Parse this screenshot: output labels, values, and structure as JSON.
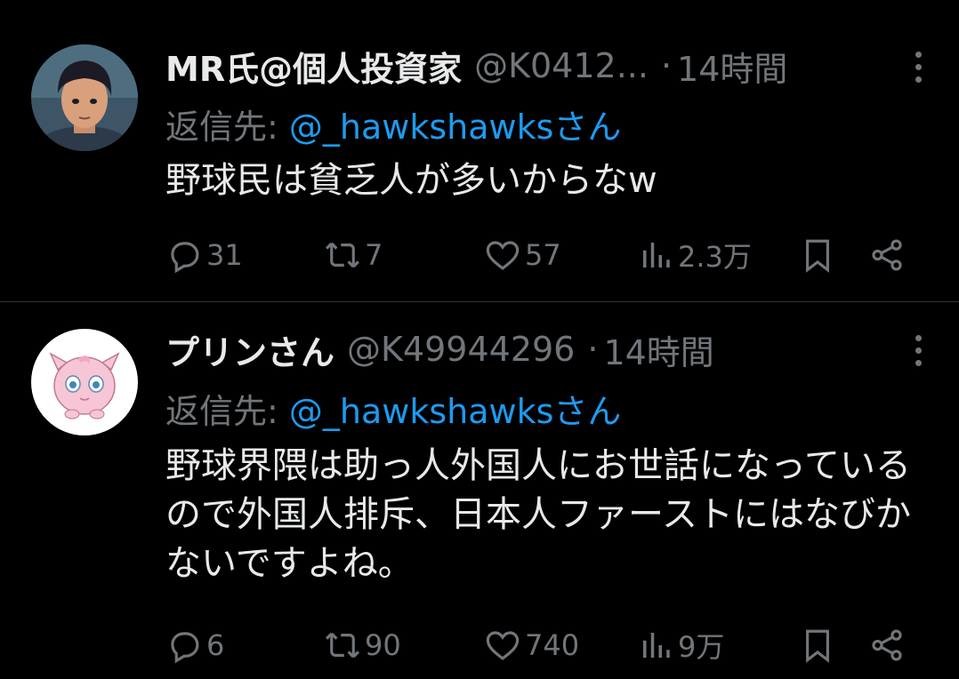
{
  "tweets": [
    {
      "name": "MR氏@個人投資家",
      "handle": "@K0412...",
      "separator": "·",
      "time": "14時間",
      "reply_prefix": "返信先:",
      "reply_to": "@_hawkshawksさん",
      "text": "野球民は貧乏人が多いからなw",
      "replies": "31",
      "retweets": "7",
      "likes": "57",
      "views": "2.3万"
    },
    {
      "name": "プリンさん",
      "handle": "@K49944296",
      "separator": "·",
      "time": "14時間",
      "reply_prefix": "返信先:",
      "reply_to": "@_hawkshawksさん",
      "text": "野球界隈は助っ人外国人にお世話になっているので外国人排斥、日本人ファーストにはなびかないですよね。",
      "replies": "6",
      "retweets": "90",
      "likes": "740",
      "views": "9万"
    }
  ],
  "colors": {
    "background": "#000000",
    "text": "#e7e9ea",
    "muted": "#71767b",
    "link": "#1d9bf0"
  },
  "icons": [
    "reply-icon",
    "retweet-icon",
    "like-icon",
    "views-icon",
    "bookmark-icon",
    "share-icon",
    "more-icon"
  ]
}
